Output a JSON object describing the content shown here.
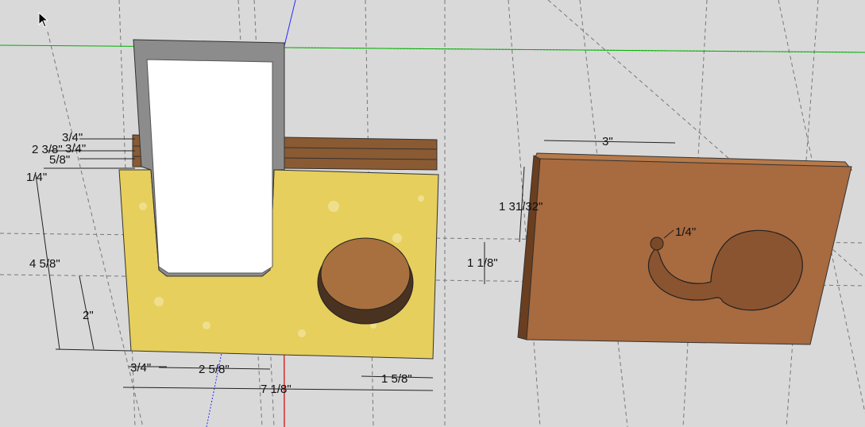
{
  "app": {
    "bg_color": "#d9d9d9",
    "axis_colors": {
      "red": "#d40000",
      "green": "#00b000",
      "blue": "#2a2aff"
    },
    "cursor_icon": "arrow-cursor-icon"
  },
  "materials": {
    "yellow_block": "#e9d46a",
    "yellow_block_edge": "#c9b046",
    "wood_face": "#a86a3f",
    "wood_edge": "#6a3e1f",
    "wood_top": "#b77a4a",
    "insert_frame": "#8c8c8c",
    "insert_face": "#ffffff"
  },
  "dimensions": {
    "d_3_4_top": "3/4\"",
    "d_2_3_8": "2 3/8\"",
    "d_3_4_top2": "3/4\"",
    "d_5_8": "5/8\"",
    "d_1_4_left": "1/4\"",
    "d_4_5_8": "4 5/8\"",
    "d_2": "2\"",
    "d_3_4_bottom": "3/4\"",
    "d_2_5_8": "2 5/8\"",
    "d_7_1_8": "7 1/8\"",
    "d_1_5_8": "1 5/8\"",
    "d_1_1_8": "1 1/8\"",
    "d_3": "3\"",
    "d_1_31_32": "1 31/32\"",
    "d_1_4_hole": "1/4\""
  }
}
